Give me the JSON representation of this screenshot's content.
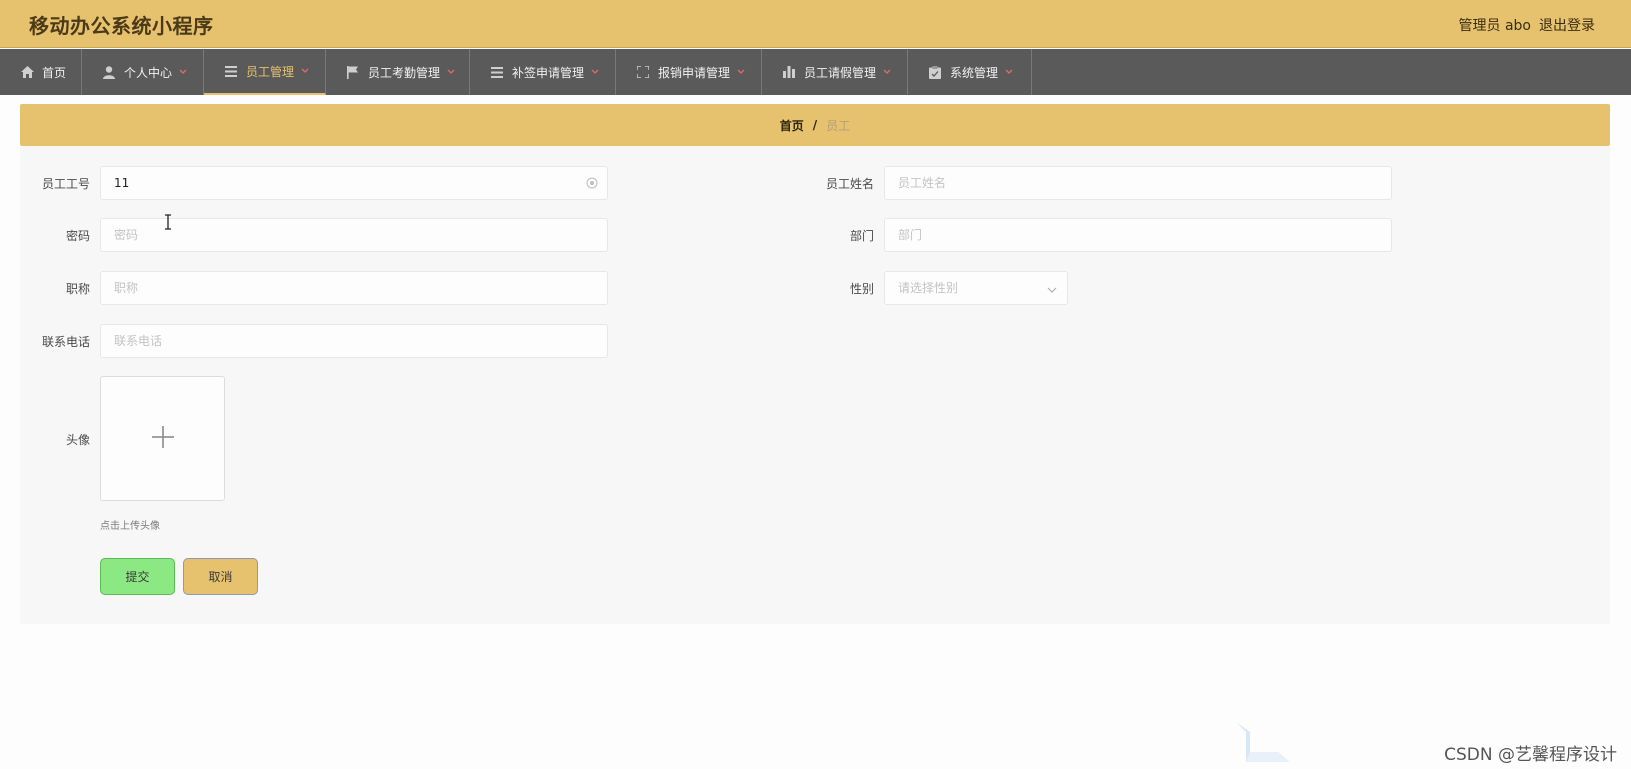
{
  "header": {
    "title": "移动办公系统小程序",
    "user": "管理员 abo",
    "logout": "退出登录"
  },
  "nav": [
    {
      "label": "首页",
      "icon": "home-icon",
      "has_dropdown": false
    },
    {
      "label": "个人中心",
      "icon": "user-icon",
      "has_dropdown": true
    },
    {
      "label": "员工管理",
      "icon": "list-icon",
      "has_dropdown": true,
      "active": true
    },
    {
      "label": "员工考勤管理",
      "icon": "flag-icon",
      "has_dropdown": true
    },
    {
      "label": "补签申请管理",
      "icon": "list-icon",
      "has_dropdown": true
    },
    {
      "label": "报销申请管理",
      "icon": "fullscreen-icon",
      "has_dropdown": true
    },
    {
      "label": "员工请假管理",
      "icon": "bar-chart-icon",
      "has_dropdown": true
    },
    {
      "label": "系统管理",
      "icon": "clipboard-icon",
      "has_dropdown": true
    }
  ],
  "breadcrumb": {
    "home": "首页",
    "separator": "/",
    "current": "员工"
  },
  "form": {
    "employee_no": {
      "label": "员工工号",
      "value": "11",
      "placeholder": ""
    },
    "employee_name": {
      "label": "员工姓名",
      "value": "",
      "placeholder": "员工姓名"
    },
    "password": {
      "label": "密码",
      "value": "",
      "placeholder": "密码"
    },
    "department": {
      "label": "部门",
      "value": "",
      "placeholder": "部门"
    },
    "title": {
      "label": "职称",
      "value": "",
      "placeholder": "职称"
    },
    "gender": {
      "label": "性别",
      "value": "",
      "placeholder": "请选择性别"
    },
    "phone": {
      "label": "联系电话",
      "value": "",
      "placeholder": "联系电话"
    },
    "avatar": {
      "label": "头像",
      "hint": "点击上传头像"
    }
  },
  "buttons": {
    "submit": "提交",
    "cancel": "取消"
  },
  "watermark": "CSDN @艺馨程序设计",
  "colors": {
    "header_bg": "#e6c16e",
    "nav_bg": "#5b5a5a",
    "nav_active": "#e6c16e",
    "submit_bg": "#8be883",
    "cancel_bg": "#e6c16e"
  }
}
